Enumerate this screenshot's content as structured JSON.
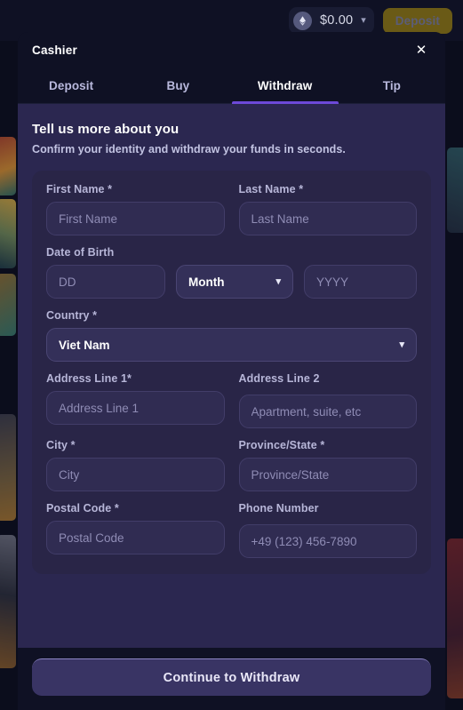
{
  "background": {
    "balance": {
      "coin_icon": "ethereum-droplet-icon",
      "amount": "$0.00",
      "caret_icon": "chevron-down-icon"
    },
    "deposit_button_label": "Deposit"
  },
  "modal": {
    "title": "Cashier",
    "close_icon": "close-icon",
    "tabs": [
      {
        "label": "Deposit",
        "active": false
      },
      {
        "label": "Buy",
        "active": false
      },
      {
        "label": "Withdraw",
        "active": true
      },
      {
        "label": "Tip",
        "active": false
      }
    ],
    "section": {
      "title": "Tell us more about you",
      "subtitle": "Confirm your identity and withdraw your funds in seconds."
    },
    "form": {
      "first_name": {
        "label": "First Name *",
        "placeholder": "First Name",
        "value": ""
      },
      "last_name": {
        "label": "Last Name *",
        "placeholder": "Last Name",
        "value": ""
      },
      "date_of_birth": {
        "label": "Date of Birth",
        "day": {
          "placeholder": "DD",
          "value": ""
        },
        "month": {
          "value": "Month",
          "chevron_icon": "chevron-down-icon"
        },
        "year": {
          "placeholder": "YYYY",
          "value": ""
        }
      },
      "country": {
        "label": "Country *",
        "value": "Viet Nam",
        "chevron_icon": "chevron-down-icon"
      },
      "address_line_1": {
        "label": "Address Line 1*",
        "placeholder": "Address Line 1",
        "value": ""
      },
      "address_line_2": {
        "label": "Address Line 2",
        "placeholder": "Apartment, suite, etc",
        "value": ""
      },
      "city": {
        "label": "City *",
        "placeholder": "City",
        "value": ""
      },
      "province_state": {
        "label": "Province/State *",
        "placeholder": "Province/State",
        "value": ""
      },
      "postal_code": {
        "label": "Postal Code *",
        "placeholder": "Postal Code",
        "value": ""
      },
      "phone_number": {
        "label": "Phone Number",
        "placeholder": "+49 (123) 456-7890",
        "value": ""
      }
    },
    "submit_button_label": "Continue to Withdraw"
  },
  "colors": {
    "page_bg": "#0b0d1c",
    "modal_chrome": "#0f1124",
    "modal_body": "#2b2750",
    "form_card": "#292547",
    "input_bg": "#302c52",
    "select_bg": "#343059",
    "accent_purple": "#6d49d8",
    "submit_bg": "#393464",
    "deposit_gold": "#6a5a16",
    "label_text": "#b7b6d8",
    "placeholder_text": "#8f8cb5"
  }
}
